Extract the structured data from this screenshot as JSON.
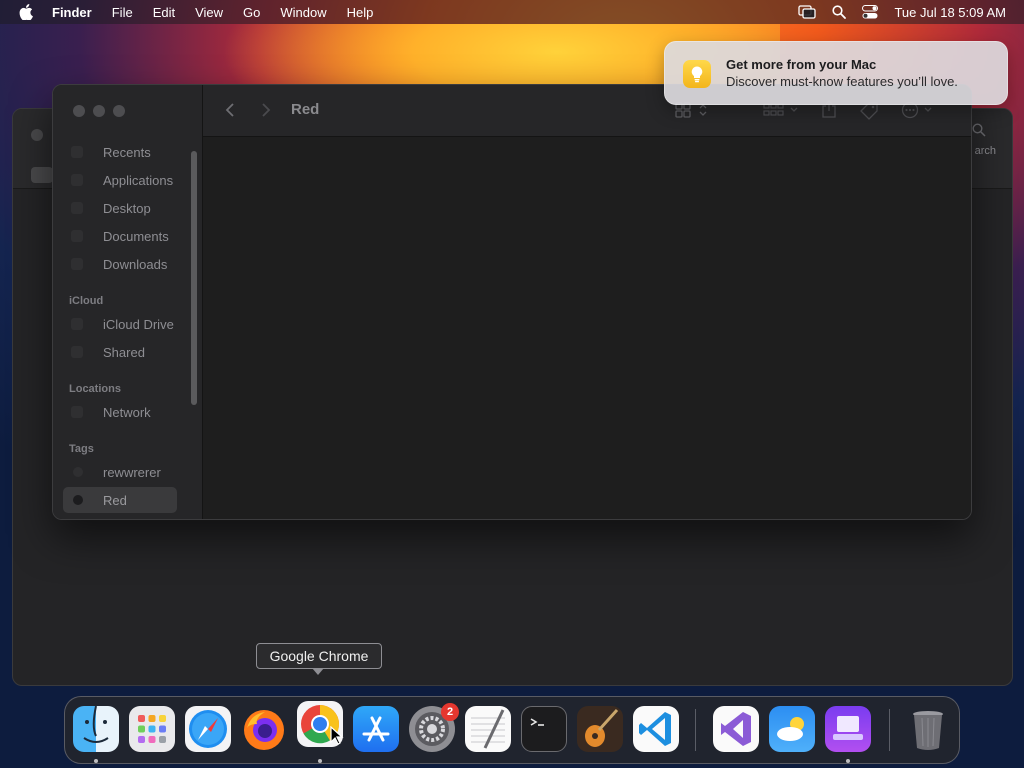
{
  "menubar": {
    "app_name": "Finder",
    "menus": [
      "File",
      "Edit",
      "View",
      "Go",
      "Window",
      "Help"
    ],
    "datetime": "Tue Jul 18  5:09 AM"
  },
  "background_window": {
    "search_label": "arch"
  },
  "finder": {
    "title": "Red",
    "sidebar": {
      "favorites": [
        "Recents",
        "Applications",
        "Desktop",
        "Documents",
        "Downloads"
      ],
      "icloud_heading": "iCloud",
      "icloud": [
        "iCloud Drive",
        "Shared"
      ],
      "locations_heading": "Locations",
      "locations": [
        "Network"
      ],
      "tags_heading": "Tags",
      "tags": [
        "rewwrerer",
        "Red"
      ],
      "selected": "Red"
    }
  },
  "notification": {
    "title": "Get more from your Mac",
    "body": "Discover must-know features you’ll love.",
    "icon": "lightbulb-icon"
  },
  "tooltip": {
    "label": "Google Chrome"
  },
  "dock": {
    "apps": [
      "Finder",
      "Launchpad",
      "Safari",
      "Firefox",
      "Google Chrome",
      "App Store",
      "System Settings",
      "TextEdit",
      "Terminal",
      "GarageBand",
      "Visual Studio Code",
      "Visual Studio",
      "Weather",
      "Simulator",
      "Trash"
    ],
    "system_settings_badge": "2"
  },
  "colors": {
    "accent_notification": "#f3b51b",
    "badge": "#e5372f",
    "window_bg": "#1e1e1e"
  }
}
